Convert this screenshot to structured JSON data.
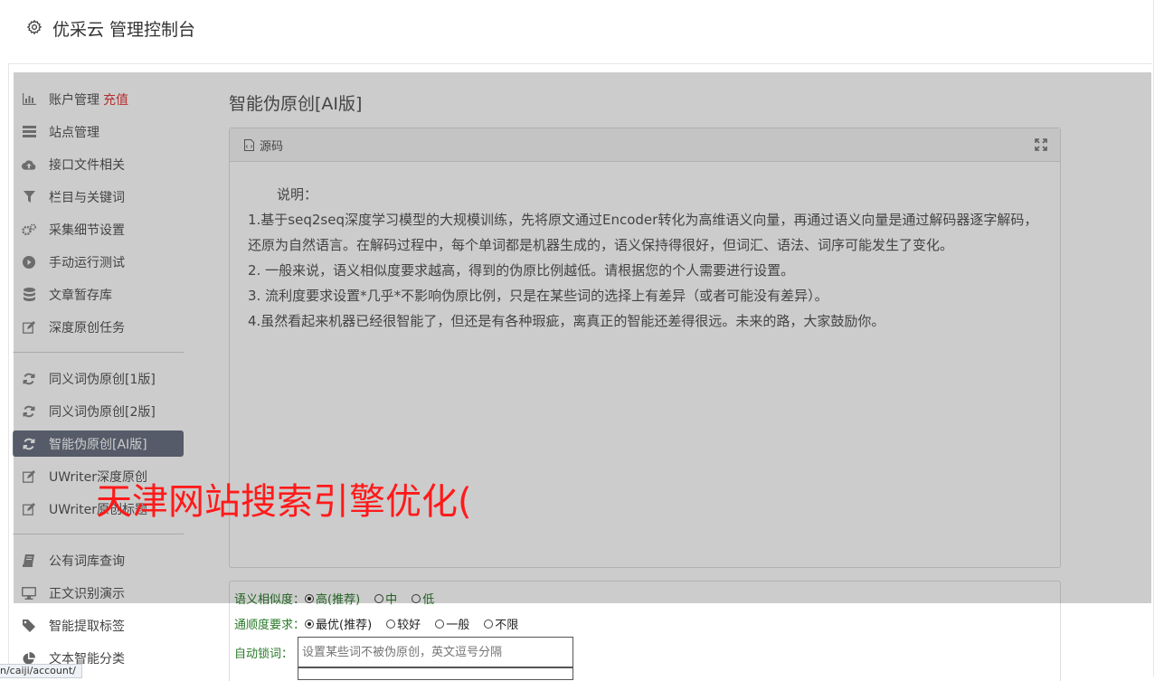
{
  "header": {
    "title": "优采云 管理控制台",
    "icon": "gear-icon"
  },
  "sidebar": {
    "group1": [
      {
        "label": "账户管理",
        "extra": "充值",
        "icon": "bar-chart-icon",
        "active": false
      },
      {
        "label": "站点管理",
        "icon": "server-icon",
        "active": false
      },
      {
        "label": "接口文件相关",
        "icon": "cloud-upload-icon",
        "active": false
      },
      {
        "label": "栏目与关键词",
        "icon": "filter-icon",
        "active": false
      },
      {
        "label": "采集细节设置",
        "icon": "gears-icon",
        "active": false
      },
      {
        "label": "手动运行测试",
        "icon": "play-icon",
        "active": false
      },
      {
        "label": "文章暂存库",
        "icon": "database-icon",
        "active": false
      },
      {
        "label": "深度原创任务",
        "icon": "edit-icon",
        "active": false
      }
    ],
    "group2": [
      {
        "label": "同义词伪原创[1版]",
        "icon": "refresh-icon",
        "active": false
      },
      {
        "label": "同义词伪原创[2版]",
        "icon": "refresh-icon",
        "active": false
      },
      {
        "label": "智能伪原创[AI版]",
        "icon": "refresh-icon",
        "active": true
      },
      {
        "label": "UWriter深度原创",
        "icon": "edit-icon",
        "active": false
      },
      {
        "label": "UWriter原创标题",
        "icon": "edit-icon",
        "active": false
      }
    ],
    "group3": [
      {
        "label": "公有词库查询",
        "icon": "book-icon",
        "active": false
      },
      {
        "label": "正文识别演示",
        "icon": "monitor-icon",
        "active": false
      },
      {
        "label": "智能提取标签",
        "icon": "tag-icon",
        "active": false
      },
      {
        "label": "文本智能分类",
        "icon": "pie-chart-icon",
        "active": false
      }
    ]
  },
  "main": {
    "title": "智能伪原创[AI版]",
    "panel": {
      "header": "源码",
      "lines": [
        "说明：",
        "1.基于seq2seq深度学习模型的大规模训练，先将原文通过Encoder转化为高维语义向量，再通过语义向量是通过解码器逐字解码，还原为自然语言。在解码过程中，每个单词都是机器生成的，语义保持得很好，但词汇、语法、词序可能发生了变化。",
        "2. 一般来说，语义相似度要求越高，得到的伪原比例越低。请根据您的个人需要进行设置。",
        "3. 流利度要求设置*几乎*不影响伪原比例，只是在某些词的选择上有差异（或者可能没有差异）。",
        "4.虽然看起来机器已经很智能了，但还是有各种瑕疵，离真正的智能还差得很远。未来的路，大家鼓励你。"
      ]
    },
    "form": {
      "similarity": {
        "label": "语义相似度：",
        "options": [
          "高(推荐)",
          "中",
          "低"
        ],
        "selected": 0
      },
      "fluency": {
        "label": "通顺度要求：",
        "options": [
          "最优(推荐)",
          "较好",
          "一般",
          "不限"
        ],
        "selected": 0
      },
      "lock": {
        "label": "自动锁词：",
        "placeholder": "设置某些词不被伪原创，英文逗号分隔"
      }
    }
  },
  "watermark": "天津网站搜索引擎优化(",
  "statusbar": "n/caiji/account/"
}
